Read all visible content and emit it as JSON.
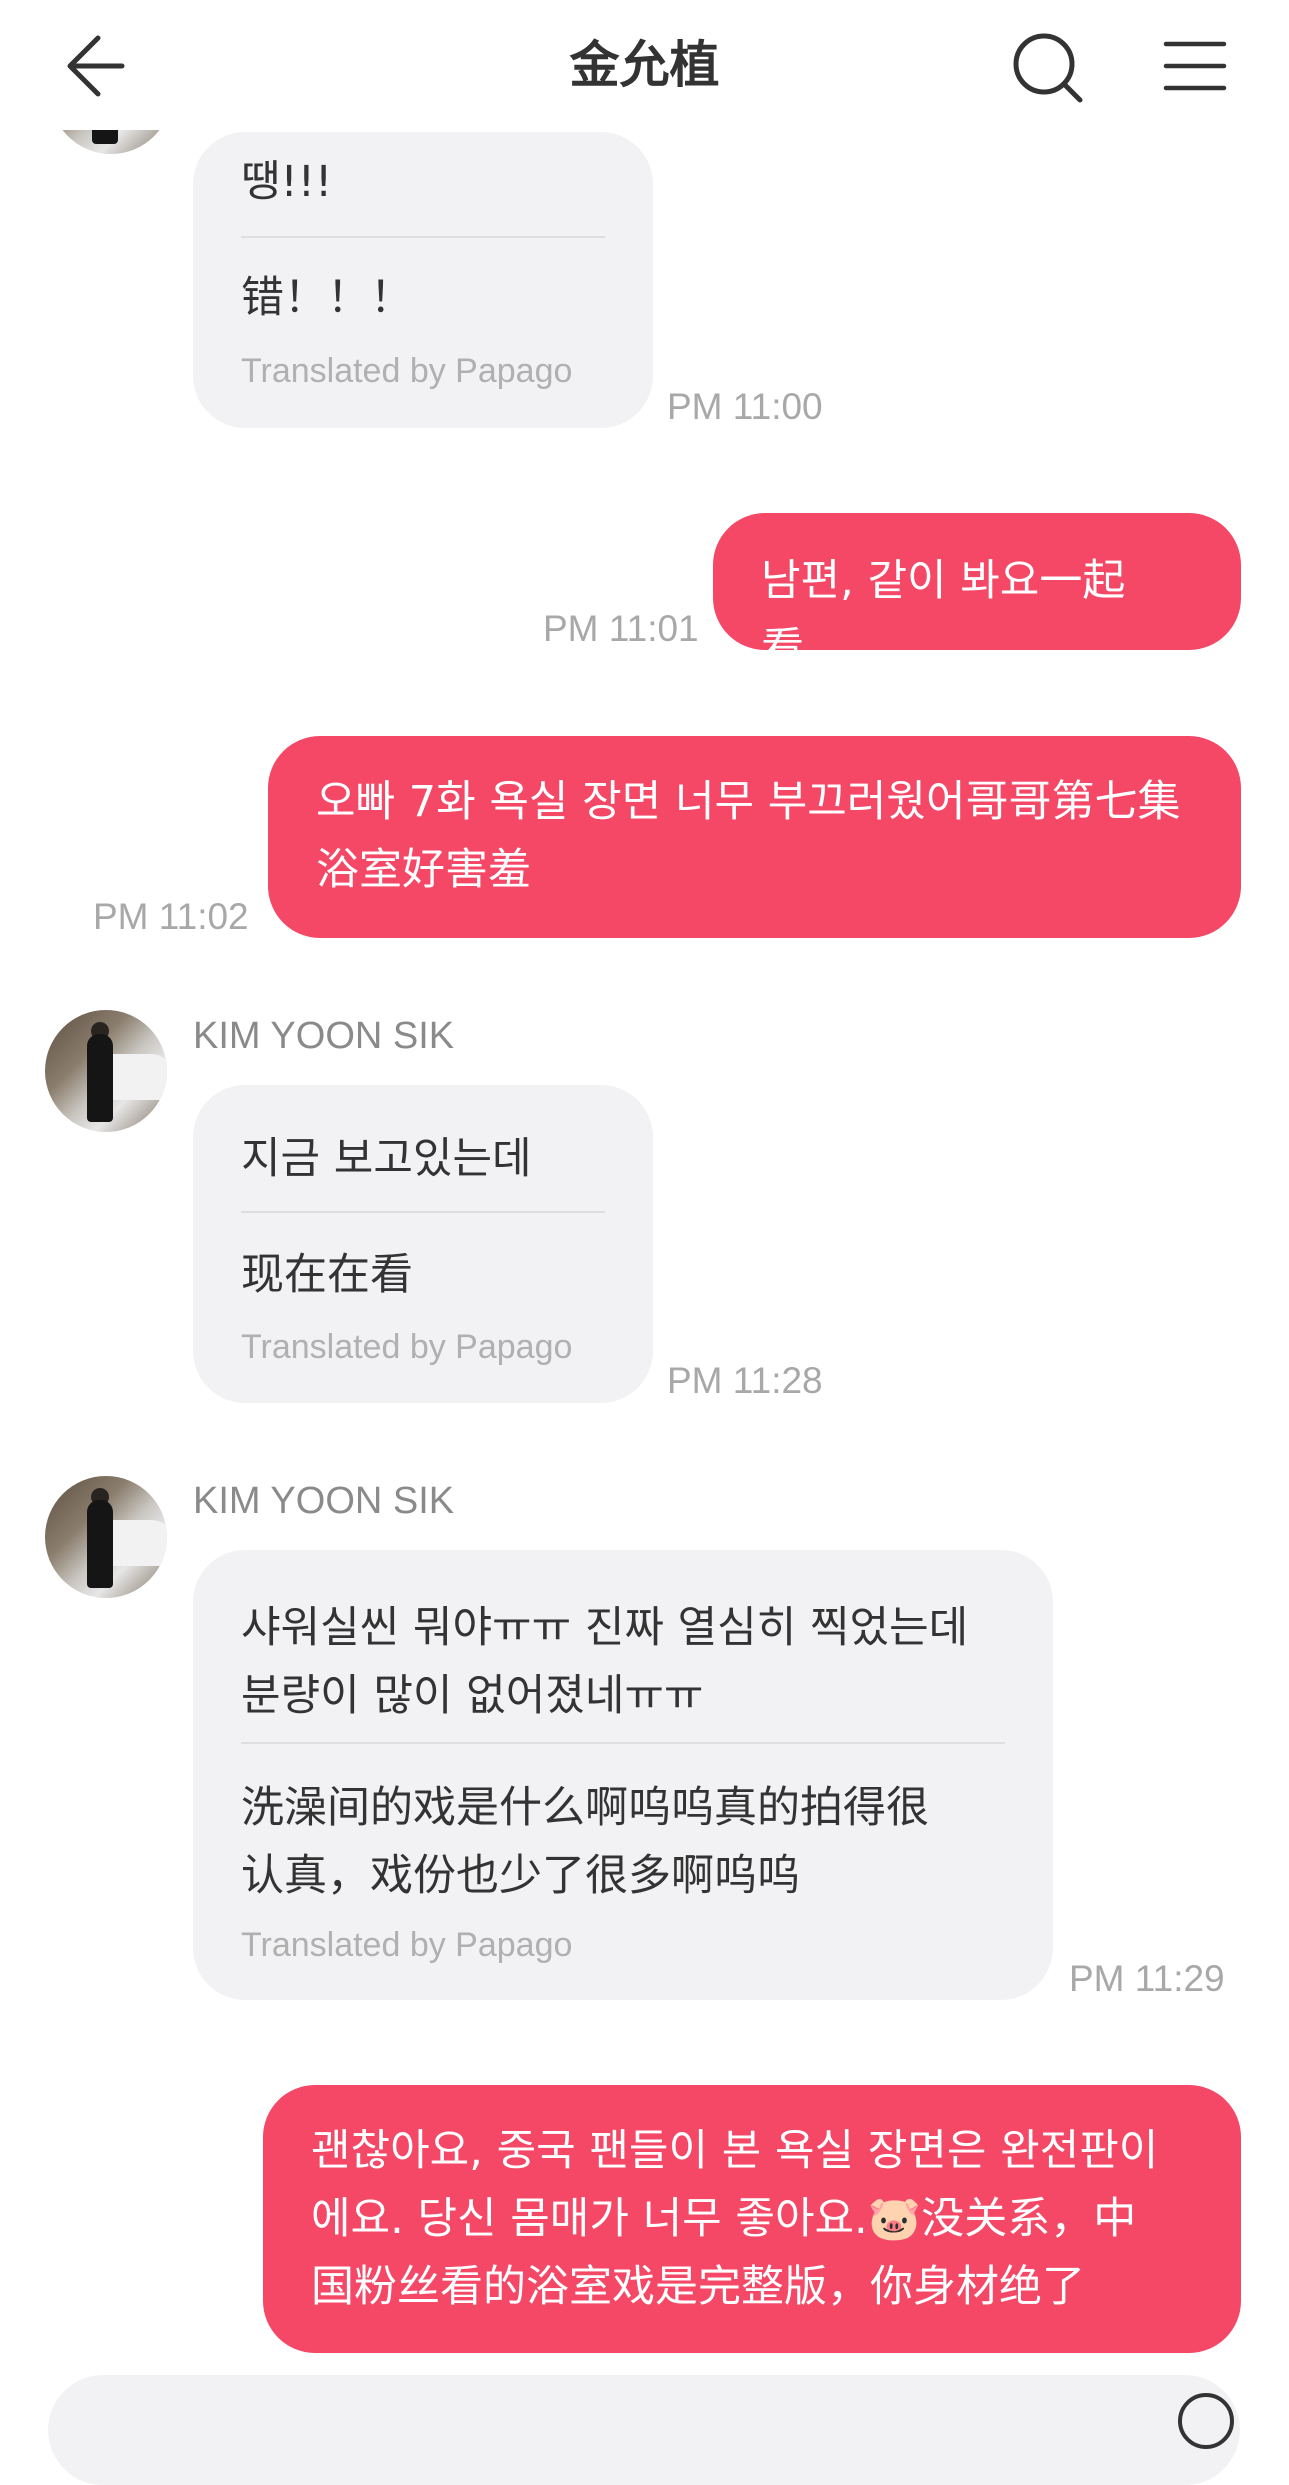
{
  "header": {
    "title": "金允植"
  },
  "messages": [
    {
      "type": "in",
      "korean": "땡!!!",
      "translation": "错！！！",
      "translated_by": "Translated by Papago",
      "time": "PM 11:00"
    },
    {
      "type": "out",
      "text": "남편, 같이 봐요一起看，",
      "time": "PM 11:01"
    },
    {
      "type": "out",
      "text": "오빠 7화 욕실 장면 너무 부끄러웠어哥哥第七集\n浴室好害羞",
      "time": "PM 11:02"
    },
    {
      "type": "in",
      "sender": "KIM YOON SIK",
      "korean": "지금 보고있는데",
      "translation": "现在在看",
      "translated_by": "Translated by Papago",
      "time": "PM 11:28"
    },
    {
      "type": "in",
      "sender": "KIM YOON SIK",
      "korean": "샤워실씬 뭐야ㅠㅠ 진짜 열심히 찍었는데\n분량이 많이 없어졌네ㅠㅠ",
      "translation": "洗澡间的戏是什么啊呜呜真的拍得很\n认真，戏份也少了很多啊呜呜",
      "translated_by": "Translated by Papago",
      "time": "PM 11:29"
    },
    {
      "type": "out",
      "text": "괜찮아요, 중국 팬들이 본 욕실 장면은 완전판이\n에요. 당신 몸매가 너무 좋아요.🐷没关系，中\n国粉丝看的浴室戏是完整版，你身材绝了"
    }
  ],
  "colors": {
    "outgoing_bubble": "#f54766",
    "incoming_bubble": "#f2f2f4"
  }
}
